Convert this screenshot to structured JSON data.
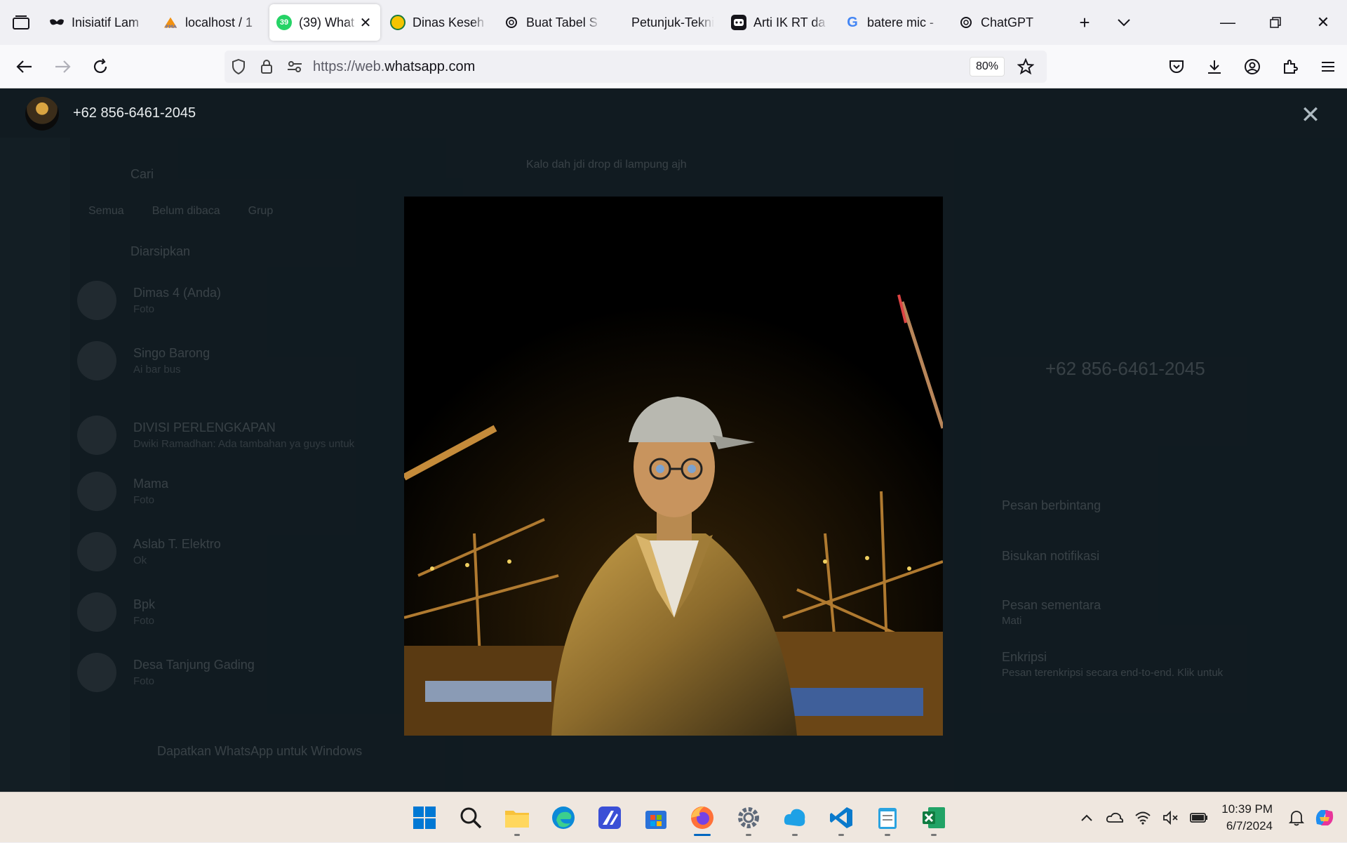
{
  "browser": {
    "tabs": [
      {
        "label": "Inisiatif Lam",
        "favicon": "mask-icon",
        "active": false
      },
      {
        "label": "localhost / 1",
        "favicon": "phpmyadmin-icon",
        "active": false
      },
      {
        "label": "(39) What",
        "favicon": "whatsapp-icon",
        "badge": "39",
        "active": true
      },
      {
        "label": "Dinas Keseh",
        "favicon": "health-office-icon",
        "active": false
      },
      {
        "label": "Buat Tabel S",
        "favicon": "chatgpt-icon",
        "active": false
      },
      {
        "label": "Petunjuk-Teknis",
        "favicon": "",
        "active": false
      },
      {
        "label": "Arti IK RT da",
        "favicon": "robot-icon",
        "active": false
      },
      {
        "label": "batere mic -",
        "favicon": "google-icon",
        "active": false
      },
      {
        "label": "ChatGPT",
        "favicon": "chatgpt-icon",
        "active": false
      }
    ],
    "url_prefix": "https://web.",
    "url_domain": "whatsapp.com",
    "zoom": "80%"
  },
  "viewer": {
    "contact_name": "+62 856-6461-2045"
  },
  "background": {
    "search_placeholder": "Cari",
    "filters": [
      "Semua",
      "Belum dibaca",
      "Grup"
    ],
    "archived": "Diarsipkan",
    "chats": [
      {
        "name": "Dimas 4 (Anda)",
        "preview": "Foto"
      },
      {
        "name": "Singo Barong",
        "preview": "Ai bar bus"
      },
      {
        "name": "DIVISI PERLENGKAPAN",
        "preview": "Dwiki Ramadhan: Ada tambahan ya guys untuk"
      },
      {
        "name": "Mama",
        "preview": "Foto"
      },
      {
        "name": "Aslab T. Elektro",
        "preview": "Ok"
      },
      {
        "name": "Bpk",
        "preview": "Foto"
      },
      {
        "name": "Desa Tanjung Gading",
        "preview": "Foto"
      }
    ],
    "message": "Kalo dah jdi drop di lampung ajh",
    "profile_number": "+62 856-6461-2045",
    "profile_items": [
      "Pesan berbintang",
      "Bisukan notifikasi",
      "Pesan sementara",
      "Enkripsi"
    ],
    "ephemeral_value": "Mati",
    "encryption_desc": "Pesan terenkripsi secara end-to-end. Klik untuk",
    "download_banner": "Dapatkan WhatsApp untuk Windows"
  },
  "taskbar": {
    "apps": [
      "windows-start-icon",
      "search-icon",
      "file-explorer-icon",
      "edge-icon",
      "app-icon",
      "store-icon",
      "firefox-icon",
      "settings-icon",
      "cloud-app-icon",
      "vscode-icon",
      "notepad-icon",
      "excel-icon"
    ],
    "time": "10:39 PM",
    "date": "6/7/2024"
  }
}
